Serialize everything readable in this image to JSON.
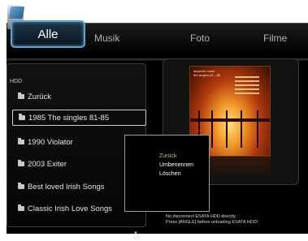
{
  "tabs": [
    {
      "label": "Alle",
      "active": true
    },
    {
      "label": "Musik",
      "active": false
    },
    {
      "label": "Foto",
      "active": false
    },
    {
      "label": "Filme",
      "active": false
    }
  ],
  "list": {
    "header": "HDD",
    "items": [
      {
        "label": "Zurück",
        "selected": false
      },
      {
        "label": "1985 The singles 81-85",
        "selected": true
      },
      {
        "label": "1990 Violator",
        "selected": false
      },
      {
        "label": "2003 Exiter",
        "selected": false
      },
      {
        "label": "Best loved Irish Songs",
        "selected": false
      },
      {
        "label": "Classic Irish Love Songs",
        "selected": false
      }
    ],
    "page_indicator": "▼ 1/3"
  },
  "context_menu": {
    "items": [
      {
        "label": "Zurück",
        "focused": true
      },
      {
        "label": "Umbenennen",
        "focused": false
      },
      {
        "label": "Löschen",
        "focused": false
      }
    ]
  },
  "preview": {
    "cover_text": [
      "depeche mode",
      "the singles 81→85"
    ]
  },
  "status": {
    "line1": "No disconnect ESATA HDD directly.",
    "line2": "Press [ANGLE] before unloading ESATA HDD!"
  },
  "colors": {
    "tab_highlight": "#5fa5d3",
    "menu_focus": "#9fdb6b"
  }
}
